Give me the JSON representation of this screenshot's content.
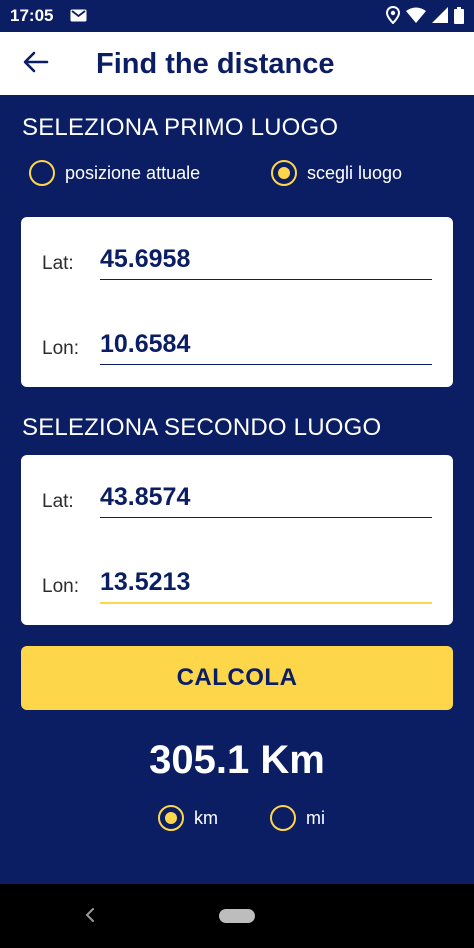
{
  "status_bar": {
    "time": "17:05",
    "icons": [
      "gmail-icon",
      "location-icon",
      "wifi-icon",
      "signal-icon",
      "battery-icon"
    ]
  },
  "app_bar": {
    "title": "Find the distance",
    "back_icon": "arrow-left-icon"
  },
  "first_place": {
    "section_title": "SELEZIONA PRIMO LUOGO",
    "options": [
      {
        "label": "posizione attuale",
        "selected": false
      },
      {
        "label": "scegli luogo",
        "selected": true
      }
    ],
    "lat_label": "Lat:",
    "lat_value": "45.6958",
    "lon_label": "Lon:",
    "lon_value": "10.6584"
  },
  "second_place": {
    "section_title": "SELEZIONA SECONDO LUOGO",
    "lat_label": "Lat:",
    "lat_value": "43.8574",
    "lon_label": "Lon:",
    "lon_value": "13.5213"
  },
  "calculate_button": "CALCOLA",
  "result": "305.1 Km",
  "units": [
    {
      "label": "km",
      "selected": true
    },
    {
      "label": "mi",
      "selected": false
    }
  ],
  "colors": {
    "background": "#0b1e63",
    "accent": "#fdd64a",
    "card": "#ffffff"
  }
}
